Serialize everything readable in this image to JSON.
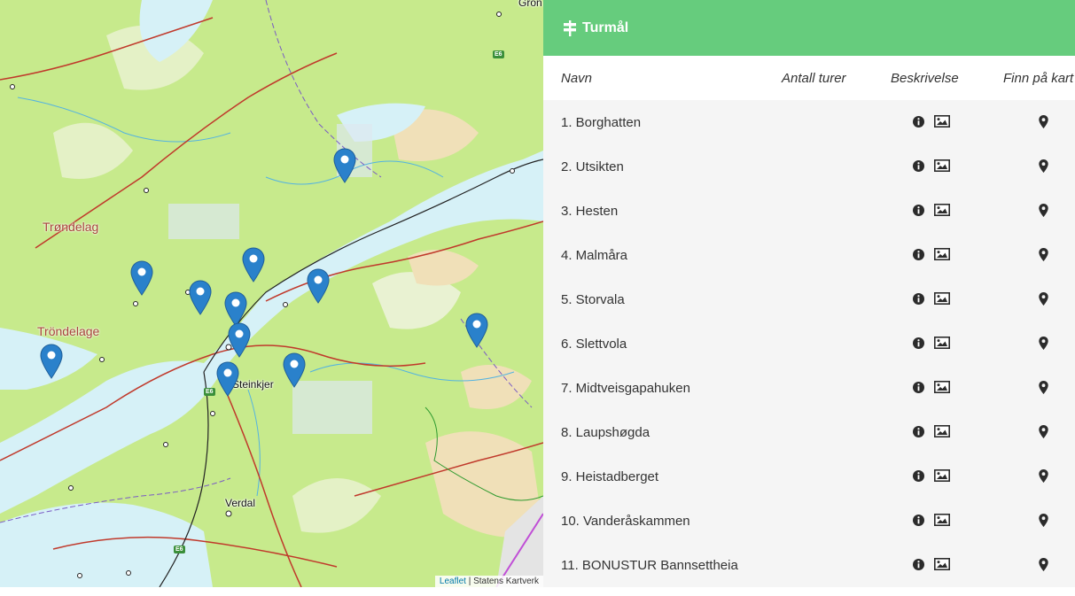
{
  "panel": {
    "title": "Turmål",
    "columns": {
      "name": "Navn",
      "count": "Antall turer",
      "description": "Beskrivelse",
      "find": "Finn på kart"
    },
    "rows": [
      {
        "name": "1. Borghatten"
      },
      {
        "name": "2. Utsikten"
      },
      {
        "name": "3. Hesten"
      },
      {
        "name": "4. Malmåra"
      },
      {
        "name": "5. Storvala"
      },
      {
        "name": "6. Slettvola"
      },
      {
        "name": "7. Midtveisgapahuken"
      },
      {
        "name": "8. Laupshøgda"
      },
      {
        "name": "9. Heistadberget"
      },
      {
        "name": "10. Vanderåskammen"
      },
      {
        "name": "11. BONUSTUR Bannsettheia"
      }
    ]
  },
  "map": {
    "labels": {
      "region": "Trøndelag",
      "region_alt": "Tröndelage",
      "town1": "Steinkjer",
      "town2": "Verdal",
      "corner": "Gron"
    },
    "road_shields": [
      "E6",
      "E6",
      "E6"
    ],
    "attribution": {
      "link": "Leaflet",
      "text": "| Statens Kartverk"
    },
    "marker_count": 11,
    "marker_color": "#2a81cb"
  },
  "colors": {
    "header_green": "#66cc7d",
    "row_bg": "#f5f5f5",
    "map_land": "#c7ea8c",
    "map_water": "#d6f1f7"
  }
}
